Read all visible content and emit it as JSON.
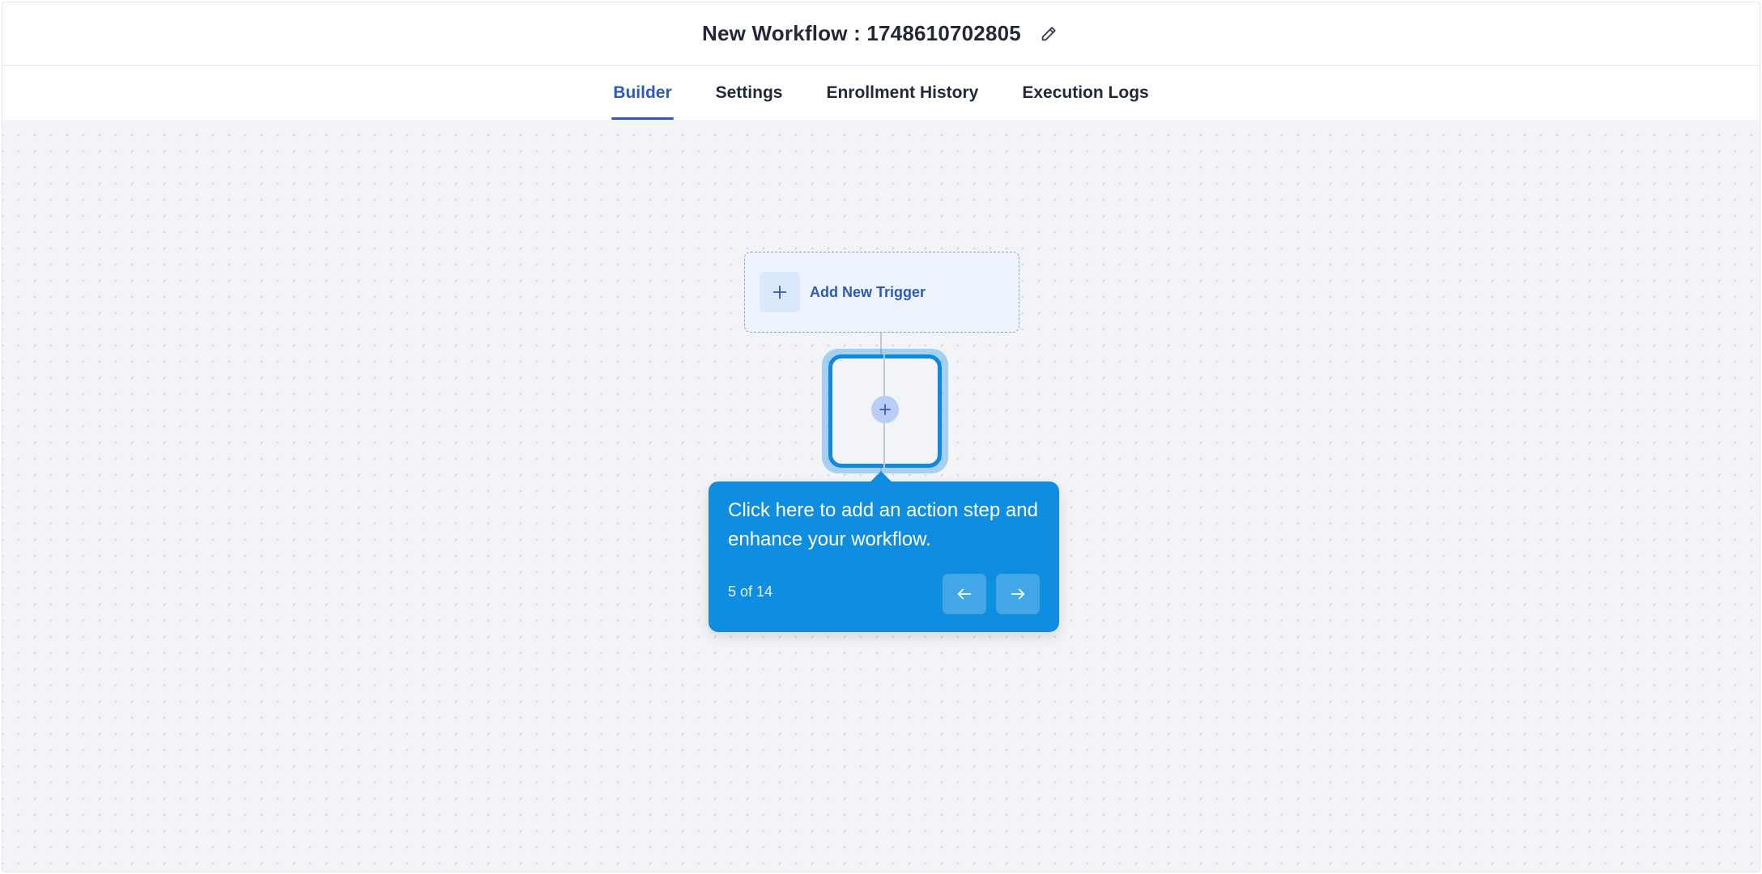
{
  "header": {
    "title": "New Workflow : 1748610702805",
    "edit_icon": "pencil-icon"
  },
  "tabs": [
    {
      "label": "Builder",
      "active": true
    },
    {
      "label": "Settings",
      "active": false
    },
    {
      "label": "Enrollment History",
      "active": false
    },
    {
      "label": "Execution Logs",
      "active": false
    }
  ],
  "builder": {
    "trigger": {
      "label": "Add New Trigger",
      "icon": "plus-icon"
    },
    "add_action_icon": "plus-icon"
  },
  "tour": {
    "message": "Click here to add an action step and enhance your workflow.",
    "step": "5 of 14",
    "prev_icon": "arrow-left-icon",
    "next_icon": "arrow-right-icon"
  },
  "colors": {
    "accent": "#2d5bb5",
    "tooltip": "#0f8de0",
    "canvas": "#f3f4f7"
  }
}
